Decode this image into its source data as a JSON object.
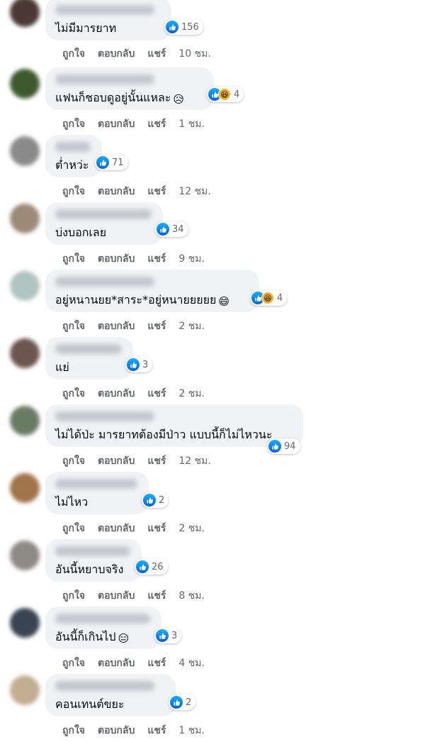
{
  "labels": {
    "like": "ถูกใจ",
    "reply": "ตอบกลับ",
    "share": "แชร์"
  },
  "comments": [
    {
      "text": "ไม่มีมารยาท",
      "emoji": "",
      "reactions": [
        "like"
      ],
      "count": "156",
      "time": "10 ชม.",
      "avatar_color": "#4a3a35"
    },
    {
      "text": "แฟนก็ชอบดูอยู่นั้นแหละ",
      "emoji": "😥",
      "reactions": [
        "like",
        "haha"
      ],
      "count": "4",
      "time": "1 ชม.",
      "avatar_color": "#3d5a2f"
    },
    {
      "text": "ต่ำหว่ะ",
      "emoji": "",
      "reactions": [
        "like"
      ],
      "count": "71",
      "time": "12 ชม.",
      "avatar_color": "#8a8a8a"
    },
    {
      "text": "บ่งบอกเลย",
      "emoji": "",
      "reactions": [
        "like"
      ],
      "count": "34",
      "time": "9 ชม.",
      "avatar_color": "#9b8a78"
    },
    {
      "text": "อยู่หนานยย*สาระ*อยู่หนายยยยย",
      "emoji": "😄",
      "reactions": [
        "like",
        "haha"
      ],
      "count": "4",
      "time": "2 ชม.",
      "avatar_color": "#b0c4bf"
    },
    {
      "text": "แย่",
      "emoji": "",
      "reactions": [
        "like"
      ],
      "count": "3",
      "time": "2 ชม.",
      "avatar_color": "#6e5650"
    },
    {
      "text": "ไม่ได้ป่ะ มารยาทต้องมีป่าว แบบนี้ก็ไม่ไหวนะ",
      "emoji": "",
      "reactions": [
        "like"
      ],
      "count": "94",
      "time": "12 ชม.",
      "avatar_color": "#6a7b64"
    },
    {
      "text": "ไม่ไหว",
      "emoji": "",
      "reactions": [
        "like"
      ],
      "count": "2",
      "time": "2 ชม.",
      "avatar_color": "#a0744a"
    },
    {
      "text": "อันนี้หยาบจริง",
      "emoji": "",
      "reactions": [
        "like"
      ],
      "count": "26",
      "time": "8 ชม.",
      "avatar_color": "#8e8a85"
    },
    {
      "text": "อันนี้ก็เกินไป",
      "emoji": "😑",
      "reactions": [
        "like"
      ],
      "count": "3",
      "time": "4 ชม.",
      "avatar_color": "#3a4452"
    },
    {
      "text": "คอนเทนต์ขยะ",
      "emoji": "",
      "reactions": [
        "like"
      ],
      "count": "2",
      "time": "1 ชม.",
      "avatar_color": "#c2ad90"
    }
  ]
}
